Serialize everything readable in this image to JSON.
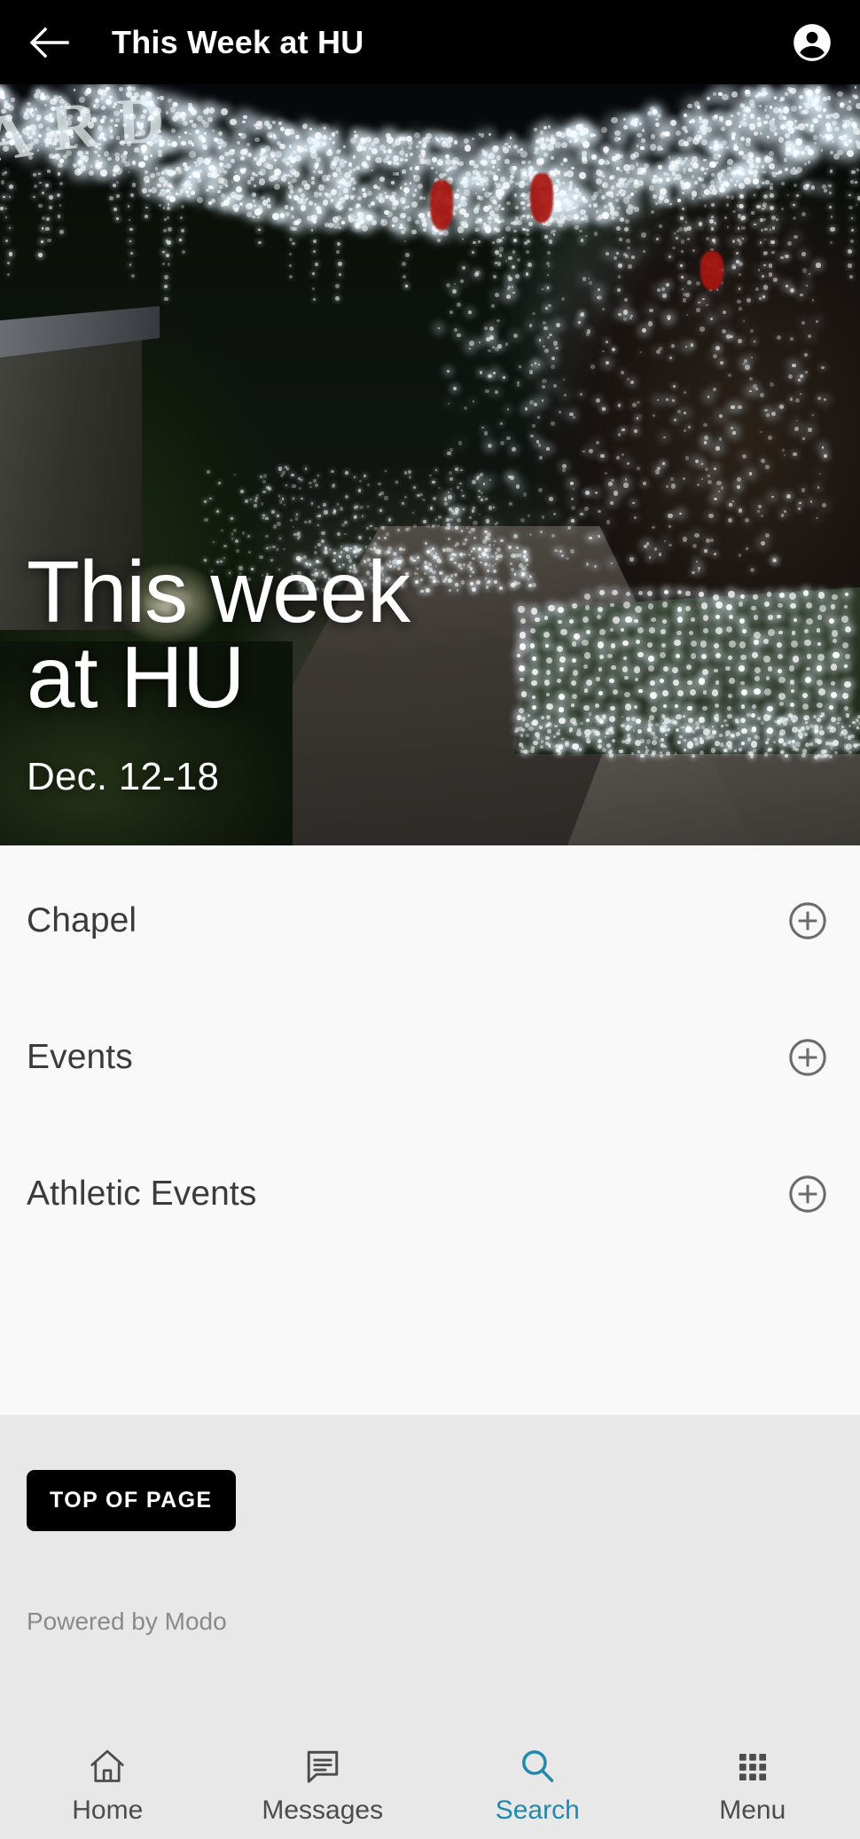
{
  "appbar": {
    "title": "This Week at HU",
    "back_icon": "arrow-left-icon",
    "account_icon": "account-circle-icon"
  },
  "hero": {
    "title": "This week at HU",
    "subtitle": "Dec. 12-18",
    "sign_text": "ARD",
    "image_description": "Night campus walkway lined with white string lights on trees and hedges"
  },
  "accordion": {
    "items": [
      {
        "label": "Chapel",
        "expand_icon": "plus-circle-icon"
      },
      {
        "label": "Events",
        "expand_icon": "plus-circle-icon"
      },
      {
        "label": "Athletic Events",
        "expand_icon": "plus-circle-icon"
      }
    ]
  },
  "footer": {
    "top_of_page_label": "TOP OF PAGE",
    "powered_by": "Powered by Modo"
  },
  "bottom_nav": {
    "active_color": "#2389ab",
    "inactive_color": "#4c4c4c",
    "items": [
      {
        "label": "Home",
        "icon": "home-icon",
        "active": false
      },
      {
        "label": "Messages",
        "icon": "messages-icon",
        "active": false
      },
      {
        "label": "Search",
        "icon": "search-icon",
        "active": true
      },
      {
        "label": "Menu",
        "icon": "grid-menu-icon",
        "active": false
      }
    ]
  },
  "colors": {
    "appbar_bg": "#000000",
    "list_bg": "#f9f9f9",
    "footer_bg": "#e8e8e8",
    "accent": "#2389ab",
    "icon_grey": "#6b6b6b"
  }
}
